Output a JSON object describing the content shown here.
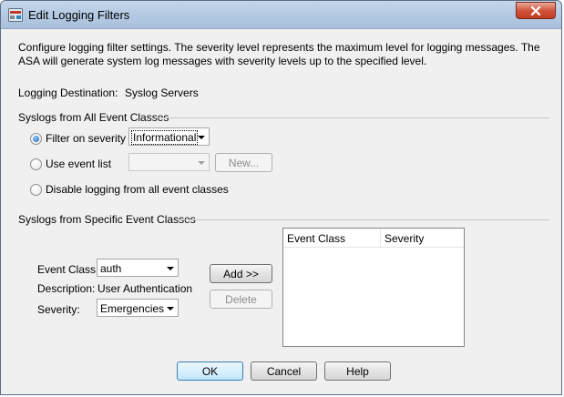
{
  "window": {
    "title": "Edit Logging Filters",
    "close_symbol": "X"
  },
  "description": "Configure logging filter settings. The severity level represents the maximum level for logging messages. The ASA will generate system log messages with severity levels up to the specified level.",
  "destination": {
    "label": "Logging Destination:",
    "value": "Syslog Servers"
  },
  "all_classes": {
    "heading": "Syslogs from All Event Classes",
    "filter_severity": {
      "label": "Filter on severity",
      "checked": true,
      "value": "Informational"
    },
    "event_list": {
      "label": "Use event list",
      "checked": false,
      "value": "",
      "new_button": "New..."
    },
    "disable_all": {
      "label": "Disable logging from all event classes",
      "checked": false
    }
  },
  "specific_classes": {
    "heading": "Syslogs from Specific Event Classes",
    "event_class": {
      "label": "Event Class:",
      "value": "auth"
    },
    "description": {
      "label": "Description:",
      "value": "User Authentication"
    },
    "severity": {
      "label": "Severity:",
      "value": "Emergencies"
    },
    "add_button": "Add >>",
    "delete_button": "Delete",
    "table": {
      "columns": [
        "Event Class",
        "Severity"
      ],
      "rows": []
    }
  },
  "footer": {
    "ok": "OK",
    "cancel": "Cancel",
    "help": "Help"
  }
}
